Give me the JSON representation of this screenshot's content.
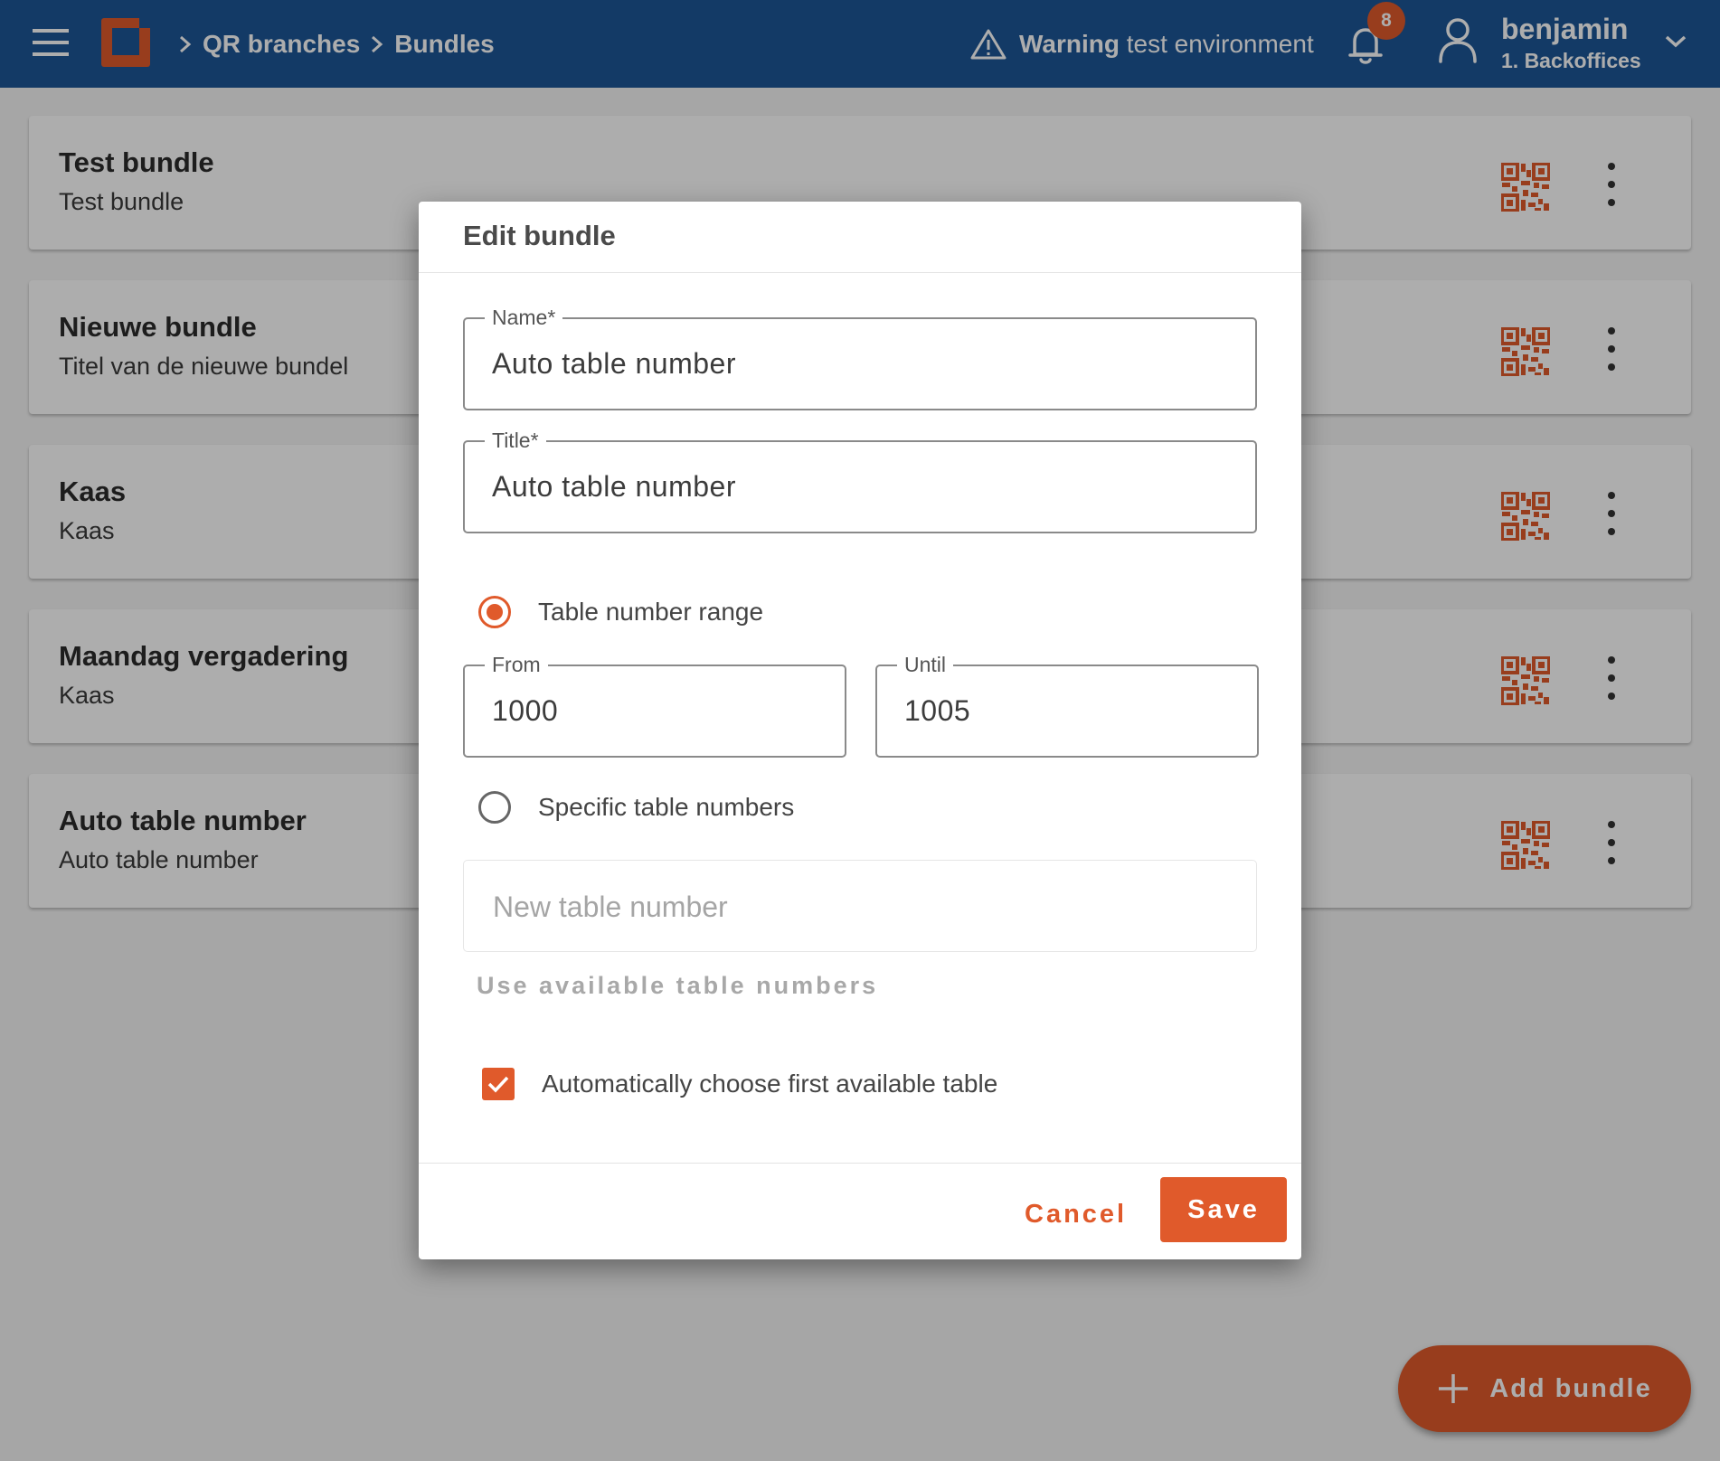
{
  "colors": {
    "header": "#1d5697",
    "accent": "#e05a2b"
  },
  "header": {
    "menu_icon": "hamburger-icon",
    "breadcrumbs": [
      "QR branches",
      "Bundles"
    ],
    "warning_bold": "Warning",
    "warning_text": "test environment",
    "notification_count": "8",
    "user_name": "benjamin",
    "user_org": "1. Backoffices"
  },
  "bundles": [
    {
      "title": "Test bundle",
      "subtitle": "Test bundle"
    },
    {
      "title": "Nieuwe bundle",
      "subtitle": "Titel van de nieuwe bundel"
    },
    {
      "title": "Kaas",
      "subtitle": "Kaas"
    },
    {
      "title": "Maandag vergadering",
      "subtitle": "Kaas"
    },
    {
      "title": "Auto table number",
      "subtitle": "Auto table number"
    }
  ],
  "fab": {
    "label": "Add bundle"
  },
  "dialog": {
    "title": "Edit bundle",
    "name_label": "Name*",
    "name_value": "Auto table number",
    "title_label": "Title*",
    "title_value": "Auto table number",
    "range_option": "Table number range",
    "range_selected": true,
    "from_label": "From",
    "from_value": "1000",
    "until_label": "Until",
    "until_value": "1005",
    "specific_option": "Specific table numbers",
    "new_table_placeholder": "New table number",
    "use_available_label": "Use available table numbers",
    "auto_choose_label": "Automatically choose first available table",
    "auto_choose_checked": true,
    "cancel_label": "Cancel",
    "save_label": "Save"
  }
}
